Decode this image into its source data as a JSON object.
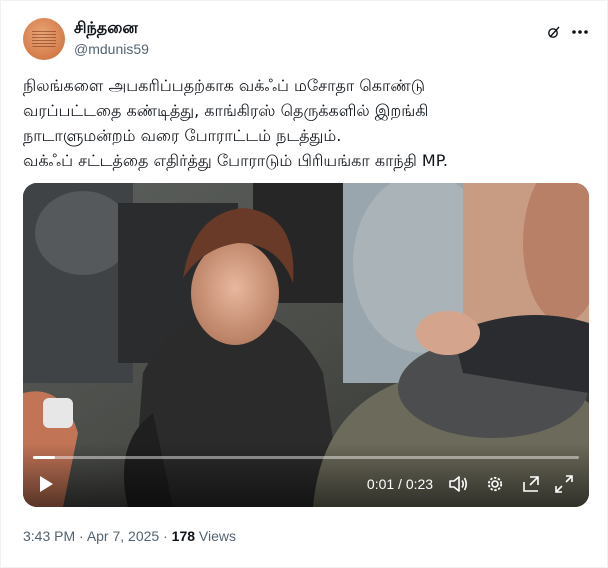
{
  "author": {
    "display_name": "சிந்தனை",
    "handle": "@mdunis59",
    "avatar_icon": "avatar-image"
  },
  "header_icons": {
    "grok": "grok-icon",
    "more": "more-icon"
  },
  "tweet": {
    "lines": [
      "நிலங்களை அபகரிப்பதற்காக வக்ஃப் மசோதா கொண்டு",
      "வரப்பட்டதை கண்டித்து, காங்கிரஸ் தெருக்களில் இறங்கி",
      "நாடாளுமன்றம் வரை போராட்டம் நடத்தும்.",
      "வக்ஃப் சட்டத்தை எதிர்த்து போராடும் பிரியங்கா காந்தி MP."
    ]
  },
  "video": {
    "time_display": "0:01 / 0:23",
    "progress_fraction": 0.04,
    "icons": [
      "play-icon",
      "volume-icon",
      "settings-icon",
      "popout-icon",
      "fullscreen-icon"
    ]
  },
  "meta": {
    "time": "3:43 PM",
    "separator": " · ",
    "date": "Apr 7, 2025",
    "views_count": "178",
    "views_label": " Views"
  },
  "colors": {
    "text_primary": "#0f1419",
    "text_secondary": "#536471",
    "background": "#ffffff"
  }
}
